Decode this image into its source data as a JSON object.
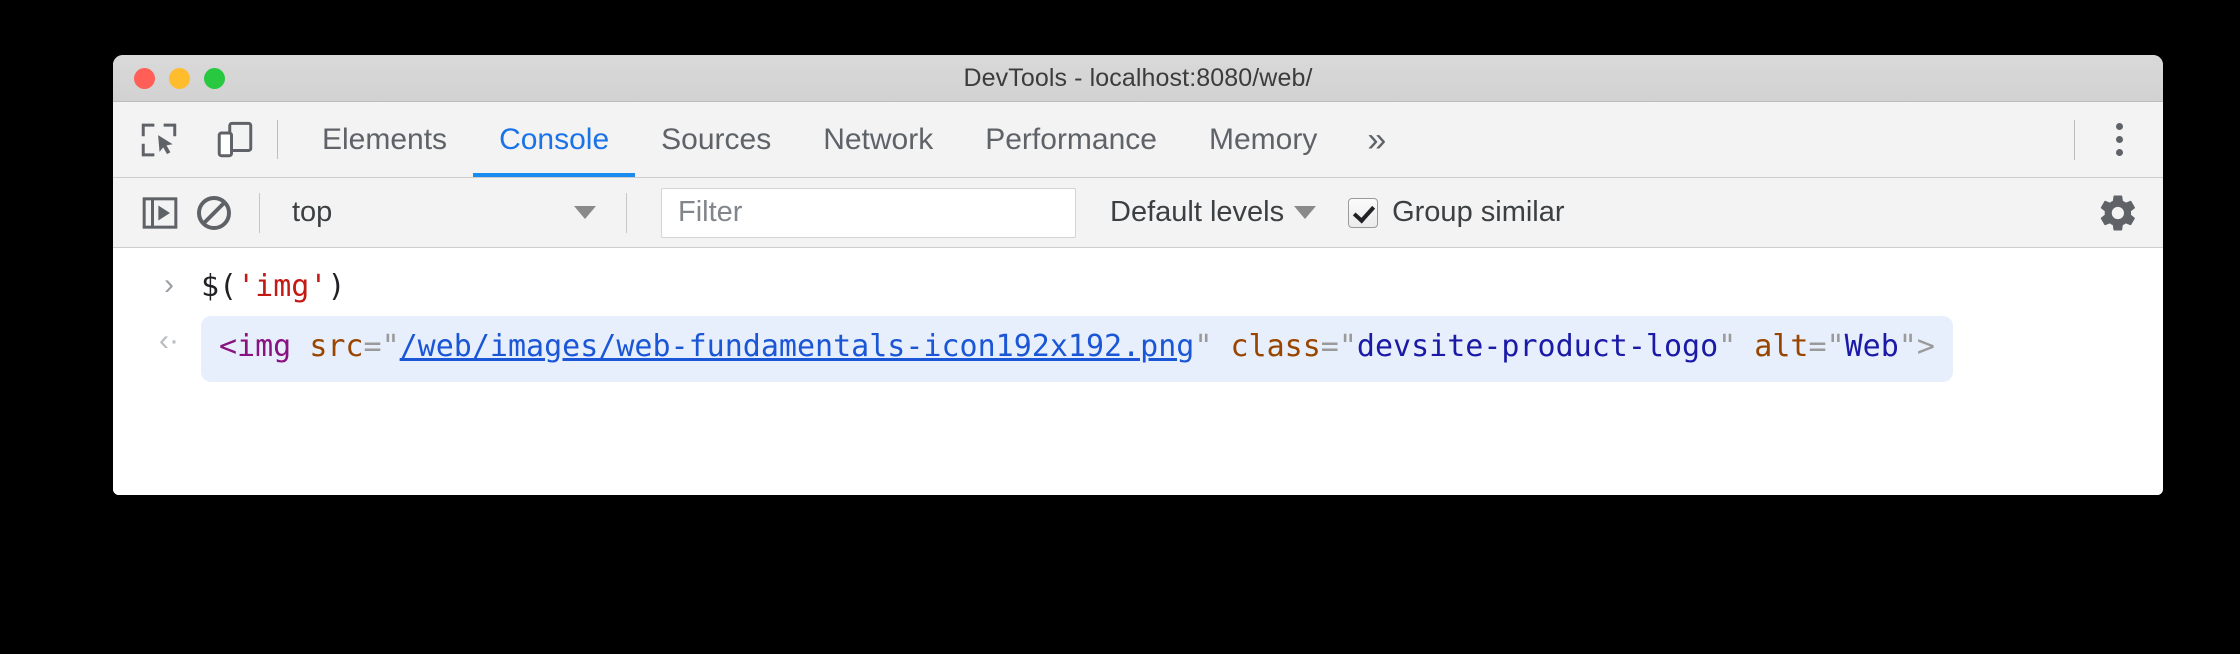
{
  "window": {
    "title": "DevTools - localhost:8080/web/",
    "traffic_lights": [
      "close",
      "minimize",
      "zoom"
    ],
    "colors": {
      "close": "#ff5f57",
      "minimize": "#ffbd2e",
      "zoom": "#28c840",
      "accent": "#1a8cf0",
      "result_background": "#e8effc"
    }
  },
  "tabbar": {
    "icons": [
      {
        "name": "inspect-element-icon",
        "title": "Inspect"
      },
      {
        "name": "device-toolbar-icon",
        "title": "Toggle device toolbar"
      }
    ],
    "tabs": [
      {
        "label": "Elements",
        "active": false
      },
      {
        "label": "Console",
        "active": true
      },
      {
        "label": "Sources",
        "active": false
      },
      {
        "label": "Network",
        "active": false
      },
      {
        "label": "Performance",
        "active": false
      },
      {
        "label": "Memory",
        "active": false
      }
    ],
    "more_tabs": "»",
    "menu_icon": "vertical-dots-icon"
  },
  "console_toolbar": {
    "sidebar_toggle_icon": "console-sidebar-icon",
    "clear_icon": "clear-console-icon",
    "context": {
      "value": "top",
      "caret": "▼"
    },
    "filter": {
      "value": "",
      "placeholder": "Filter"
    },
    "levels": {
      "label": "Default levels",
      "caret": "▼"
    },
    "group_similar": {
      "label": "Group similar",
      "checked": true
    },
    "settings_icon": "gear-icon"
  },
  "console": {
    "input": {
      "prompt": "›",
      "code_prefix": "$(",
      "code_string": "'img'",
      "code_suffix": ")",
      "full_text": "$('img')"
    },
    "result": {
      "indicator": "‹",
      "full_text": "<img src=\"/web/images/web-fundamentals-icon192x192.png\" class=\"devsite-product-logo\" alt=\"Web\">",
      "tokens": {
        "tag_open": "<img",
        "space": " ",
        "attr_src": "src",
        "equals": "=",
        "quote": "\"",
        "src_value": "/web/images/web-fundamentals-icon192x192.png",
        "attr_class": "class",
        "class_value": "devsite-product-logo",
        "attr_alt": "alt",
        "alt_value": "Web",
        "tag_close": ">"
      }
    }
  }
}
